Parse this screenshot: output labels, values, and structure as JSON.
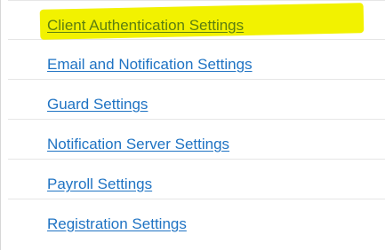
{
  "menu": {
    "items": [
      {
        "label": "Client Authentication Settings",
        "highlighted": true
      },
      {
        "label": "Email and Notification Settings",
        "highlighted": false
      },
      {
        "label": "Guard Settings",
        "highlighted": false
      },
      {
        "label": "Notification Server Settings",
        "highlighted": false
      },
      {
        "label": "Payroll Settings",
        "highlighted": false
      },
      {
        "label": "Registration Settings",
        "highlighted": false
      }
    ]
  },
  "colors": {
    "link": "#1f73c3",
    "highlight": "#f2f200",
    "highlighted_link": "#5d7f10",
    "divider": "#e6e6e6"
  }
}
